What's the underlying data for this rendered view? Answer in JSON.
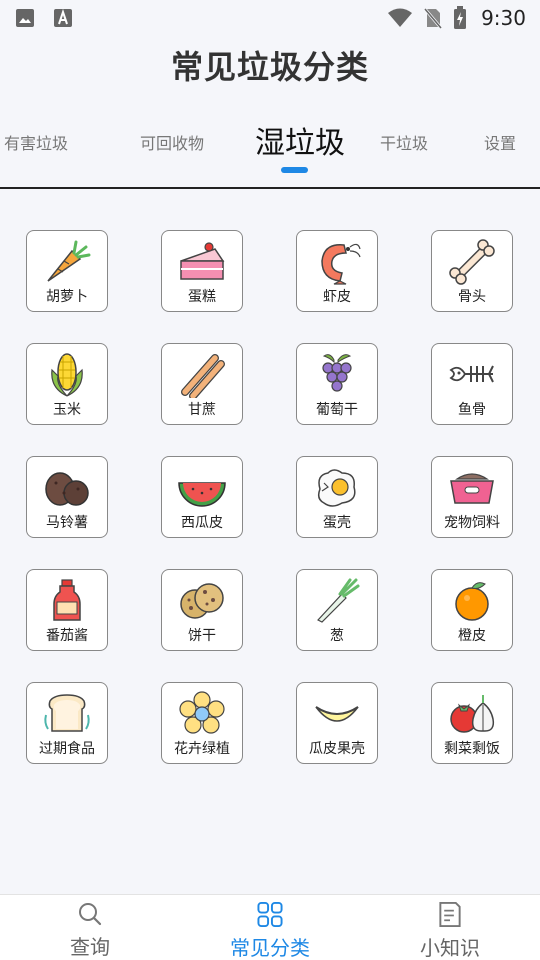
{
  "status_bar": {
    "time": "9:30"
  },
  "page": {
    "title": "常见垃圾分类"
  },
  "tabs": [
    {
      "label": "有害垃圾"
    },
    {
      "label": "可回收物"
    },
    {
      "label": "湿垃圾",
      "selected": true
    },
    {
      "label": "干垃圾"
    },
    {
      "label": "设置"
    }
  ],
  "items": [
    {
      "label": "胡萝卜",
      "icon": "carrot-icon"
    },
    {
      "label": "蛋糕",
      "icon": "cake-icon"
    },
    {
      "label": "虾皮",
      "icon": "shrimp-icon"
    },
    {
      "label": "骨头",
      "icon": "bone-icon"
    },
    {
      "label": "玉米",
      "icon": "corn-icon"
    },
    {
      "label": "甘蔗",
      "icon": "sugarcane-icon"
    },
    {
      "label": "葡萄干",
      "icon": "grapes-icon"
    },
    {
      "label": "鱼骨",
      "icon": "fishbone-icon"
    },
    {
      "label": "马铃薯",
      "icon": "potato-icon"
    },
    {
      "label": "西瓜皮",
      "icon": "watermelon-icon"
    },
    {
      "label": "蛋壳",
      "icon": "eggshell-icon"
    },
    {
      "label": "宠物饲料",
      "icon": "pet-food-icon"
    },
    {
      "label": "番茄酱",
      "icon": "ketchup-icon"
    },
    {
      "label": "饼干",
      "icon": "cookie-icon"
    },
    {
      "label": "葱",
      "icon": "scallion-icon"
    },
    {
      "label": "橙皮",
      "icon": "orange-icon"
    },
    {
      "label": "过期食品",
      "icon": "toast-icon"
    },
    {
      "label": "花卉绿植",
      "icon": "flower-icon"
    },
    {
      "label": "瓜皮果壳",
      "icon": "melon-rind-icon"
    },
    {
      "label": "剩菜剩饭",
      "icon": "leftovers-icon"
    }
  ],
  "bottom_nav": [
    {
      "label": "查询",
      "icon": "search-icon"
    },
    {
      "label": "常见分类",
      "icon": "grid-icon",
      "selected": true
    },
    {
      "label": "小知识",
      "icon": "notes-icon"
    }
  ],
  "colors": {
    "accent": "#1e88e5",
    "background": "#f5f6fa"
  }
}
